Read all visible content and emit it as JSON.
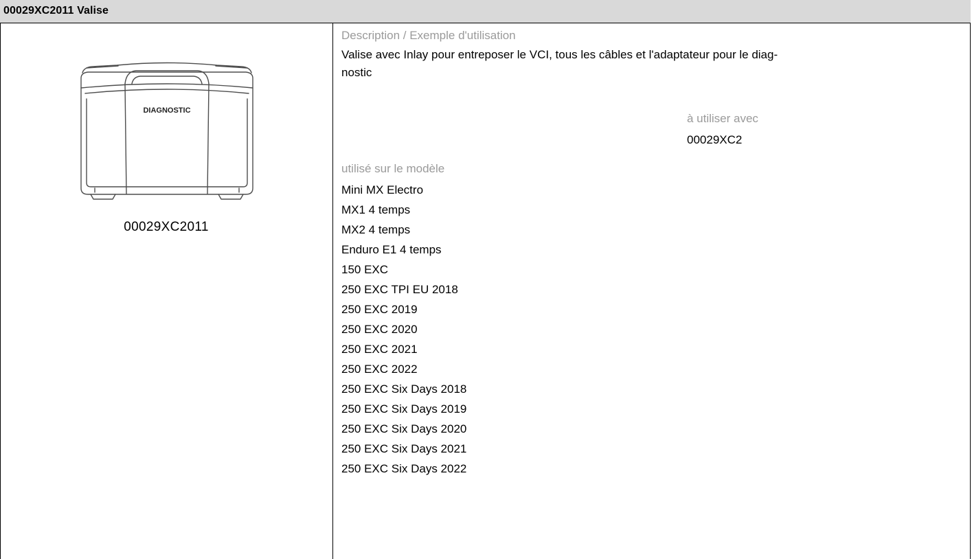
{
  "header": {
    "title": "00029XC2011 Valise"
  },
  "product": {
    "image_icon": "diagnostic-case-icon",
    "case_label": "DIAGNOSTIC",
    "caption": "00029XC2011"
  },
  "description": {
    "label": "Description / Exemple d'utilisation",
    "line1": "Valise avec Inlay pour entreposer le VCI, tous les câbles et l'adaptateur pour le diag-",
    "line2": "nostic"
  },
  "use_with": {
    "label": "à utiliser avec",
    "value": "00029XC2"
  },
  "models": {
    "label": "utilisé sur le modèle",
    "items": [
      "Mini MX Electro",
      "MX1 4 temps",
      "MX2 4 temps",
      "Enduro E1 4 temps",
      "150 EXC",
      "250 EXC TPI EU 2018",
      "250 EXC 2019",
      "250 EXC 2020",
      "250 EXC 2021",
      "250 EXC 2022",
      "250 EXC Six Days 2018",
      "250 EXC Six Days 2019",
      "250 EXC Six Days 2020",
      "250 EXC Six Days 2021",
      "250 EXC Six Days 2022"
    ]
  }
}
